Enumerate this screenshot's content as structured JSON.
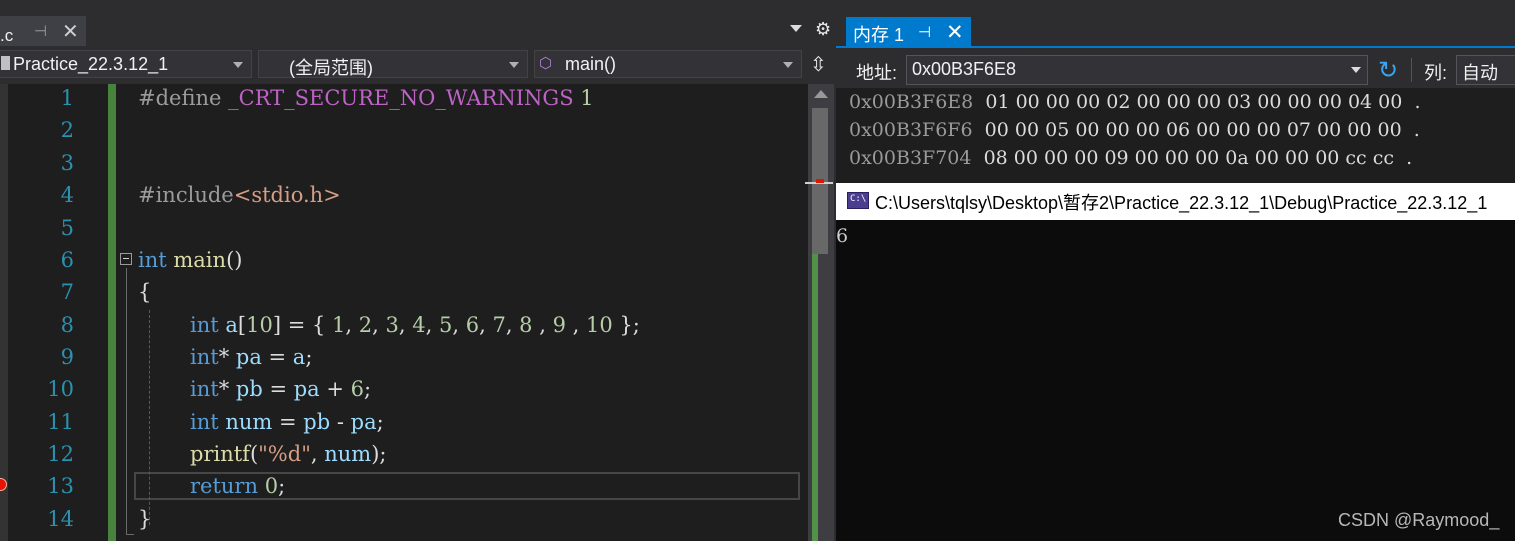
{
  "editor": {
    "tab_label": "源.c",
    "nav": {
      "project": "Practice_22.3.12_1",
      "scope": "(全局范围)",
      "member": "main()"
    },
    "line_numbers": [
      "1",
      "2",
      "3",
      "4",
      "5",
      "6",
      "7",
      "8",
      "9",
      "10",
      "11",
      "12",
      "13",
      "14"
    ],
    "current_line": 13,
    "breakpoint_line": 13
  },
  "memory": {
    "tab_label": "内存 1",
    "address_label": "地址:",
    "address_value": "0x00B3F6E8",
    "columns_label": "列:",
    "columns_value": "自动",
    "rows": [
      {
        "address": "0x00B3F6E8",
        "bytes": "01 00 00 00 02 00 00 00 03 00 00 00 04 00",
        "tail": "."
      },
      {
        "address": "0x00B3F6F6",
        "bytes": "00 00 05 00 00 00 06 00 00 00 07 00 00 00",
        "tail": "."
      },
      {
        "address": "0x00B3F704",
        "bytes": "08 00 00 00 09 00 00 00 0a 00 00 00 cc cc",
        "tail": "."
      }
    ]
  },
  "console": {
    "icon_text": "C:\\",
    "title": "C:\\Users\\tqlsy\\Desktop\\暂存2\\Practice_22.3.12_1\\Debug\\Practice_22.3.12_1",
    "output": "6"
  },
  "watermark": "CSDN @Raymood_",
  "colors": {
    "keyword": "#569cd6",
    "line_number": "#2b91af",
    "accent": "#007acc",
    "breakpoint": "#e51400"
  },
  "icons": [
    "pin-icon",
    "close-icon",
    "dropdown-icon",
    "gear-icon",
    "split-icon",
    "cube-icon",
    "refresh-icon",
    "breakpoint-icon",
    "collapse-icon"
  ]
}
